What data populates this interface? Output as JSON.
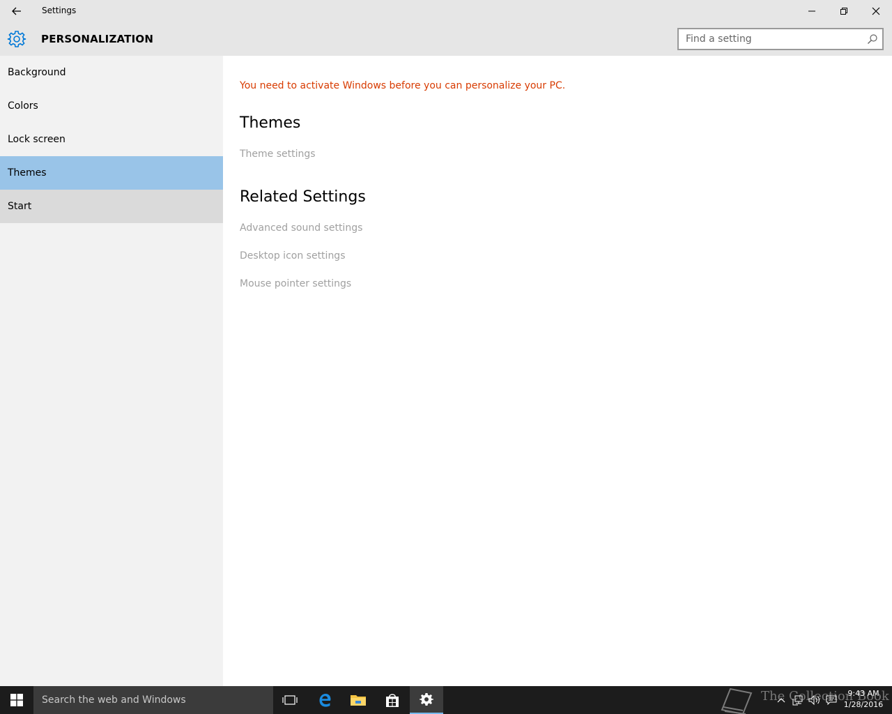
{
  "window": {
    "title": "Settings"
  },
  "header": {
    "title": "PERSONALIZATION",
    "search_placeholder": "Find a setting"
  },
  "sidebar": {
    "items": [
      {
        "label": "Background"
      },
      {
        "label": "Colors"
      },
      {
        "label": "Lock screen"
      },
      {
        "label": "Themes",
        "selected": true
      },
      {
        "label": "Start",
        "hover": true
      }
    ]
  },
  "main": {
    "warning": "You need to activate Windows before you can personalize your PC.",
    "themes_title": "Themes",
    "theme_settings_link": "Theme settings",
    "related_title": "Related Settings",
    "related_links": [
      "Advanced sound settings",
      "Desktop icon settings",
      "Mouse pointer settings"
    ]
  },
  "taskbar": {
    "search_placeholder": "Search the web and Windows",
    "watermark": "The Collection Book",
    "time": "9:43 AM",
    "date": "1/28/2016"
  },
  "colors": {
    "accent": "#0078d7",
    "selected_bg": "#99c4e8",
    "warning": "#d83b01",
    "link_disabled": "#a0a0a0"
  }
}
